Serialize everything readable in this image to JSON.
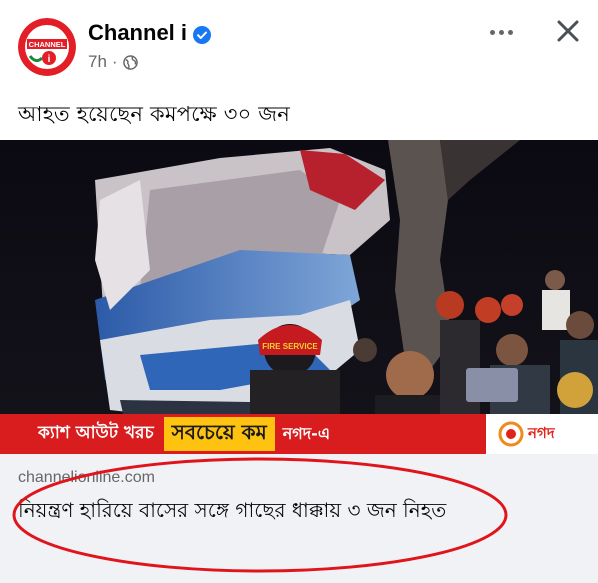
{
  "header": {
    "page_name": "Channel i",
    "timestamp": "7h",
    "separator": "·",
    "verified": true,
    "avatar_label": "CHANNEL",
    "avatar_number": "i"
  },
  "post": {
    "text": "আহত হয়েছেন কমপক্ষে ৩০ জন"
  },
  "image_overlay": {
    "helmet_text": "FIRE SERVICE"
  },
  "banner": {
    "left_text": "ক্যাশ আউট খরচ",
    "highlight_text": "সবচেয়ে কম",
    "right_text": "নগদ-এ",
    "logo_text": "নগদ"
  },
  "link": {
    "domain": "channelionline.com",
    "title": "নিয়ন্ত্রণ হারিয়ে বাসের সঙ্গে গাছের ধাক্কায় ৩ জন নিহত"
  },
  "icons": {
    "more": "more-options-icon",
    "close": "close-icon",
    "globe": "globe-icon",
    "verified": "verified-badge-icon"
  },
  "colors": {
    "verified_blue": "#1877f2",
    "annotation_red": "#e0141b",
    "banner_red": "#d91d1f",
    "banner_yellow": "#fdc310",
    "link_bg": "#f0f2f5"
  }
}
